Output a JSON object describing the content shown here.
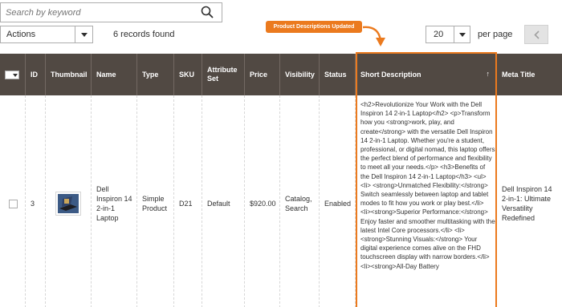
{
  "search": {
    "placeholder": "Search by keyword"
  },
  "toolbar": {
    "actions_label": "Actions",
    "records_found": "6 records found",
    "per_page_value": "20",
    "per_page_label": "per page"
  },
  "callout": {
    "text": "Product Descriptions Updated"
  },
  "colors": {
    "header_bg": "#514943",
    "accent": "#eb7a1e"
  },
  "columns": {
    "id": "ID",
    "thumbnail": "Thumbnail",
    "name": "Name",
    "type": "Type",
    "sku": "SKU",
    "attribute_set": "Attribute Set",
    "price": "Price",
    "visibility": "Visibility",
    "status": "Status",
    "short_description": "Short Description",
    "sort_indicator": "↑",
    "meta_title": "Meta Title"
  },
  "row": {
    "id": "3",
    "name": "Dell Inspiron 14 2-in-1 Laptop",
    "type": "Simple Product",
    "sku": "D21",
    "attribute_set": "Default",
    "price": "$920.00",
    "visibility": "Catalog, Search",
    "status": "Enabled",
    "short_description": "<h2>Revolutionize Your Work with the Dell Inspiron 14 2-in-1 Laptop</h2> <p>Transform how you <strong>work, play, and create</strong> with the versatile Dell Inspiron 14 2-in-1 Laptop. Whether you're a student, professional, or digital nomad, this laptop offers the perfect blend of performance and flexibility to meet all your needs.</p> <h3>Benefits of the Dell Inspiron 14 2-in-1 Laptop</h3> <ul> <li> <strong>Unmatched Flexibility:</strong> Switch seamlessly between laptop and tablet modes to fit how you work or play best.</li> <li><strong>Superior Performance:</strong> Enjoy faster and smoother multitasking with the latest Intel Core processors.</li> <li> <strong>Stunning Visuals:</strong> Your digital experience comes alive on the FHD touchscreen display with narrow borders.</li> <li><strong>All-Day Battery",
    "meta_title": "Dell Inspiron 14 2-in-1: Ultimate Versatility Redefined"
  }
}
